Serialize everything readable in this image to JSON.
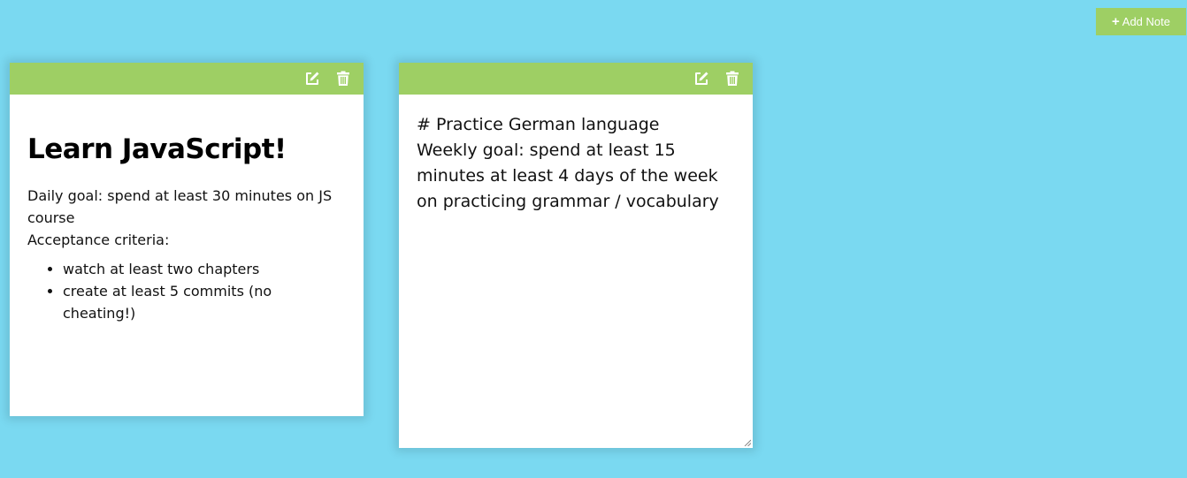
{
  "toolbar": {
    "add_label": "Add Note",
    "add_icon": "plus-icon"
  },
  "colors": {
    "background": "#7ad9f1",
    "accent": "#9ecf64",
    "note": "#ffffff"
  },
  "notes": [
    {
      "mode": "view",
      "actions": [
        "edit-icon",
        "trash-icon"
      ],
      "title": "Learn JavaScript!",
      "paragraph_line1": "Daily goal: spend at least 30 minutes on JS course",
      "paragraph_line2": "Acceptance criteria:",
      "list": [
        "watch at least two chapters",
        "create at least 5 commits (no cheating!)"
      ]
    },
    {
      "mode": "edit",
      "actions": [
        "edit-icon",
        "trash-icon"
      ],
      "editor_value": "# Practice German language\nWeekly goal: spend at least 15 minutes at least 4 days of the week on practicing grammar / vocabulary"
    }
  ]
}
